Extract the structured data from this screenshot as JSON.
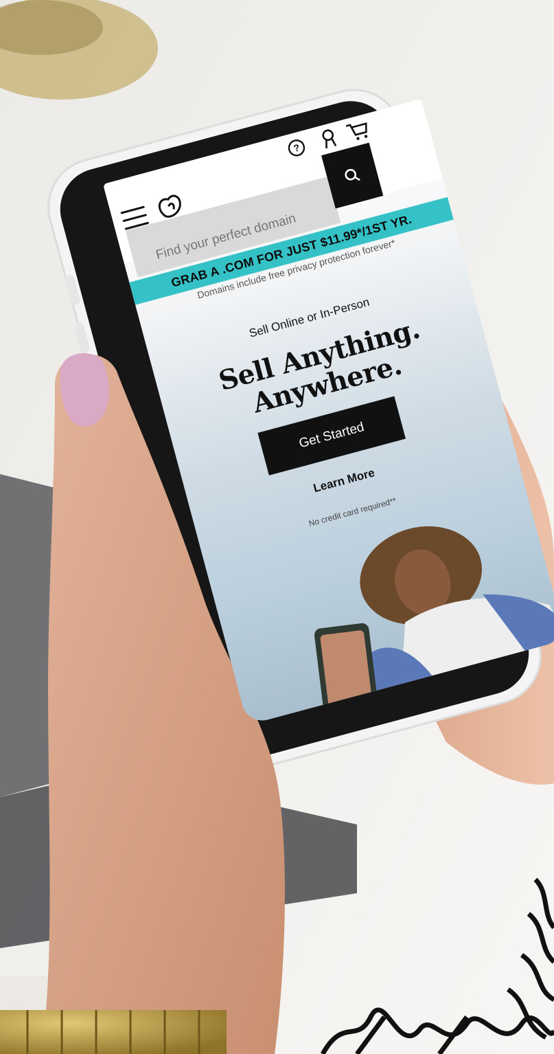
{
  "nav": {
    "menu_icon": "hamburger-menu-icon",
    "logo_icon": "godaddy-logo-icon",
    "help_icon": "question-circle-icon",
    "account_icon": "user-icon",
    "cart_icon": "shopping-cart-icon"
  },
  "search": {
    "placeholder": "Find your perfect domain",
    "button_icon": "search-icon"
  },
  "promo": {
    "banner": "GRAB A .COM FOR JUST $11.99*/1ST YR.",
    "note": "Domains include free privacy protection forever*"
  },
  "hero": {
    "eyebrow": "Sell Online or In-Person",
    "headline_line1": "Sell Anything.",
    "headline_line2": "Anywhere.",
    "cta_label": "Get Started",
    "secondary_link": "Learn More",
    "fine_print": "No credit card required**"
  },
  "colors": {
    "promo_teal": "#35c2c7",
    "cta_black": "#111111",
    "nail_pink": "#d9a9c6"
  }
}
